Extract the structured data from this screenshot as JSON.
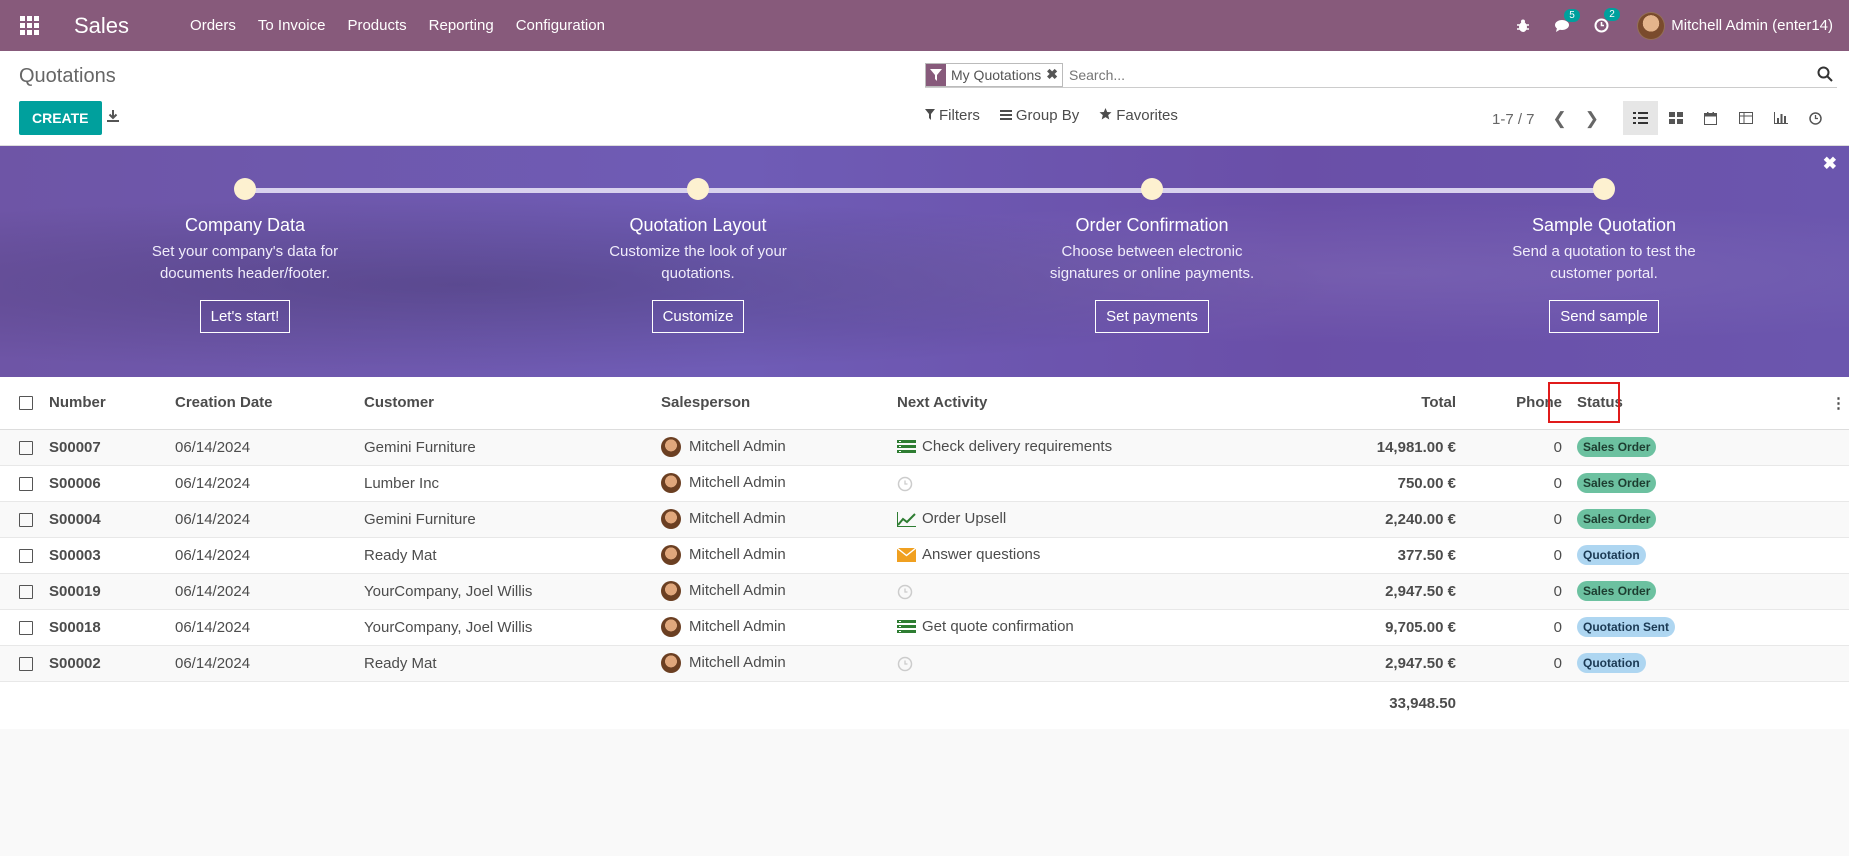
{
  "topbar": {
    "app_name": "Sales",
    "menu": [
      "Orders",
      "To Invoice",
      "Products",
      "Reporting",
      "Configuration"
    ],
    "messages_count": "5",
    "activities_count": "2",
    "user_name": "Mitchell Admin (enter14)"
  },
  "control": {
    "breadcrumb": "Quotations",
    "create_label": "CREATE",
    "facet_label": "My Quotations",
    "search_placeholder": "Search...",
    "filters_label": "Filters",
    "groupby_label": "Group By",
    "favorites_label": "Favorites",
    "pager": "1-7 / 7"
  },
  "banner": {
    "steps": [
      {
        "title": "Company Data",
        "desc1": "Set your company's data for",
        "desc2": "documents header/footer.",
        "button": "Let's start!"
      },
      {
        "title": "Quotation Layout",
        "desc1": "Customize the look of your",
        "desc2": "quotations.",
        "button": "Customize"
      },
      {
        "title": "Order Confirmation",
        "desc1": "Choose between electronic",
        "desc2": "signatures or online payments.",
        "button": "Set payments"
      },
      {
        "title": "Sample Quotation",
        "desc1": "Send a quotation to test the",
        "desc2": "customer portal.",
        "button": "Send sample"
      }
    ]
  },
  "table": {
    "headers": {
      "number": "Number",
      "creation_date": "Creation Date",
      "customer": "Customer",
      "salesperson": "Salesperson",
      "next_activity": "Next Activity",
      "total": "Total",
      "phone": "Phone",
      "status": "Status"
    },
    "rows": [
      {
        "number": "S00007",
        "date": "06/14/2024",
        "customer": "Gemini Furniture",
        "salesperson": "Mitchell Admin",
        "activity_icon": "todo-list-icon",
        "activity": "Check delivery requirements",
        "total": "14,981.00 €",
        "phone": "0",
        "status": "Sales Order"
      },
      {
        "number": "S00006",
        "date": "06/14/2024",
        "customer": "Lumber Inc",
        "salesperson": "Mitchell Admin",
        "activity_icon": "clock-icon",
        "activity": "",
        "total": "750.00 €",
        "phone": "0",
        "status": "Sales Order"
      },
      {
        "number": "S00004",
        "date": "06/14/2024",
        "customer": "Gemini Furniture",
        "salesperson": "Mitchell Admin",
        "activity_icon": "chart-up-icon",
        "activity": "Order Upsell",
        "total": "2,240.00 €",
        "phone": "0",
        "status": "Sales Order"
      },
      {
        "number": "S00003",
        "date": "06/14/2024",
        "customer": "Ready Mat",
        "salesperson": "Mitchell Admin",
        "activity_icon": "envelope-icon",
        "activity": "Answer questions",
        "total": "377.50 €",
        "phone": "0",
        "status": "Quotation"
      },
      {
        "number": "S00019",
        "date": "06/14/2024",
        "customer": "YourCompany, Joel Willis",
        "salesperson": "Mitchell Admin",
        "activity_icon": "clock-icon",
        "activity": "",
        "total": "2,947.50 €",
        "phone": "0",
        "status": "Sales Order"
      },
      {
        "number": "S00018",
        "date": "06/14/2024",
        "customer": "YourCompany, Joel Willis",
        "salesperson": "Mitchell Admin",
        "activity_icon": "todo-list-icon",
        "activity": "Get quote confirmation",
        "total": "9,705.00 €",
        "phone": "0",
        "status": "Quotation Sent"
      },
      {
        "number": "S00002",
        "date": "06/14/2024",
        "customer": "Ready Mat",
        "salesperson": "Mitchell Admin",
        "activity_icon": "clock-icon",
        "activity": "",
        "total": "2,947.50 €",
        "phone": "0",
        "status": "Quotation"
      }
    ],
    "sum_total": "33,948.50"
  },
  "colors": {
    "brand": "#875a7b",
    "primary_button": "#00a09d",
    "badge_sales_order": "#6cc1a0",
    "badge_quotation": "#aed6f1",
    "highlight": "#e01b1b"
  }
}
